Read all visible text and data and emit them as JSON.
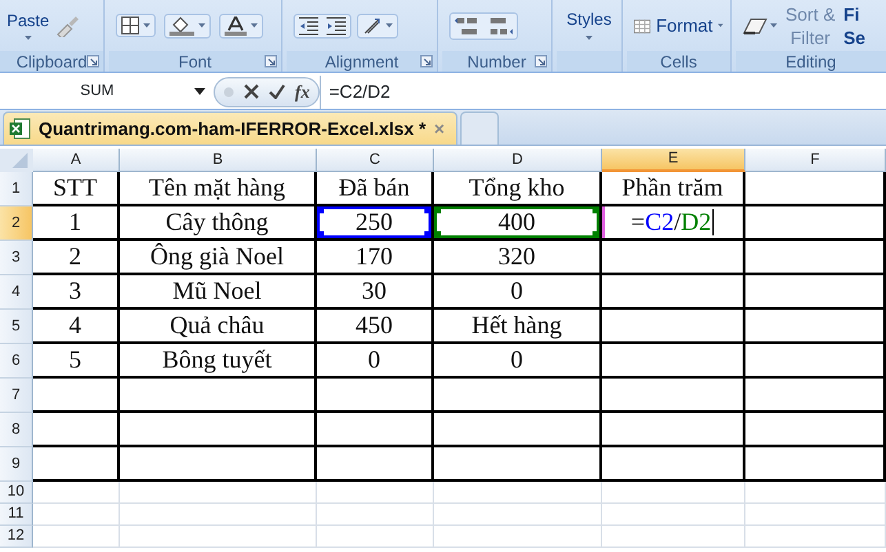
{
  "ribbon": {
    "groups": [
      {
        "kind": "clipboard",
        "label": "Clipboard",
        "buttons": [
          {
            "lines": [
              "Paste"
            ]
          }
        ]
      },
      {
        "kind": "font",
        "label": "Font"
      },
      {
        "kind": "alignment",
        "label": "Alignment"
      },
      {
        "kind": "number",
        "label": "Number"
      },
      {
        "kind": "styles",
        "buttons": [
          {
            "lines": [
              "Styles"
            ]
          }
        ]
      },
      {
        "kind": "cells",
        "label": "Cells",
        "buttons": [
          {
            "lines": [
              "Format"
            ]
          }
        ]
      },
      {
        "kind": "editing",
        "label": "Editing",
        "buttons": [
          {
            "lines": [
              "Sort &",
              "Filter"
            ]
          },
          {
            "lines": [
              "Fi",
              "Se"
            ]
          }
        ]
      }
    ]
  },
  "formula_bar": {
    "name_box": "SUM",
    "fx": "fx",
    "formula": "=C2/D2"
  },
  "workbook_tabs": [
    {
      "title": "Quantrimang.com-ham-IFERROR-Excel.xlsx *",
      "close": "×",
      "selected": true
    },
    {
      "selected": false
    }
  ],
  "sheet": {
    "columns": [
      {
        "label": "A",
        "selected": false
      },
      {
        "label": "B",
        "selected": false
      },
      {
        "label": "C",
        "selected": false
      },
      {
        "label": "D",
        "selected": false
      },
      {
        "label": "E",
        "selected": true
      },
      {
        "label": "F",
        "selected": false
      }
    ],
    "rows": [
      {
        "header": "1",
        "selected": false,
        "bordered": true,
        "cells": [
          {
            "text": "STT"
          },
          {
            "text": "Tên mặt hàng"
          },
          {
            "text": "Đã bán"
          },
          {
            "text": "Tổng kho"
          },
          {
            "text": "Phần trăm"
          }
        ]
      },
      {
        "header": "2",
        "selected": true,
        "bordered": true,
        "cells": [
          {
            "text": "1"
          },
          {
            "text": "Cây thông"
          },
          {
            "text": "250",
            "color": "#0000ff"
          },
          {
            "text": "400",
            "color": "#008000"
          },
          {
            "parts": [
              {
                "text": "="
              },
              {
                "text": "C2",
                "color": "#0000ff"
              },
              {
                "text": "/"
              },
              {
                "text": "D2",
                "color": "#008000"
              }
            ]
          }
        ]
      },
      {
        "header": "3",
        "selected": false,
        "bordered": true,
        "cells": [
          {
            "text": "2"
          },
          {
            "text": "Ông già Noel"
          },
          {
            "text": "170"
          },
          {
            "text": "320"
          }
        ]
      },
      {
        "header": "4",
        "selected": false,
        "bordered": true,
        "cells": [
          {
            "text": "3"
          },
          {
            "text": "Mũ Noel"
          },
          {
            "text": "30"
          },
          {
            "text": "0"
          }
        ]
      },
      {
        "header": "5",
        "selected": false,
        "bordered": true,
        "cells": [
          {
            "text": "4"
          },
          {
            "text": "Quả châu"
          },
          {
            "text": "450"
          },
          {
            "text": "Hết hàng"
          }
        ]
      },
      {
        "header": "6",
        "selected": false,
        "bordered": true,
        "cells": [
          {
            "text": "5"
          },
          {
            "text": "Bông tuyết"
          },
          {
            "text": "0"
          },
          {
            "text": "0"
          }
        ]
      },
      {
        "header": "7",
        "selected": false,
        "bordered": true
      },
      {
        "header": "8",
        "selected": false,
        "bordered": true
      },
      {
        "header": "9",
        "selected": false,
        "bordered": true
      },
      {
        "header": "10",
        "selected": false,
        "bordered": false
      },
      {
        "header": "11",
        "selected": false,
        "bordered": false
      },
      {
        "header": "12",
        "selected": false,
        "bordered": false
      }
    ]
  }
}
